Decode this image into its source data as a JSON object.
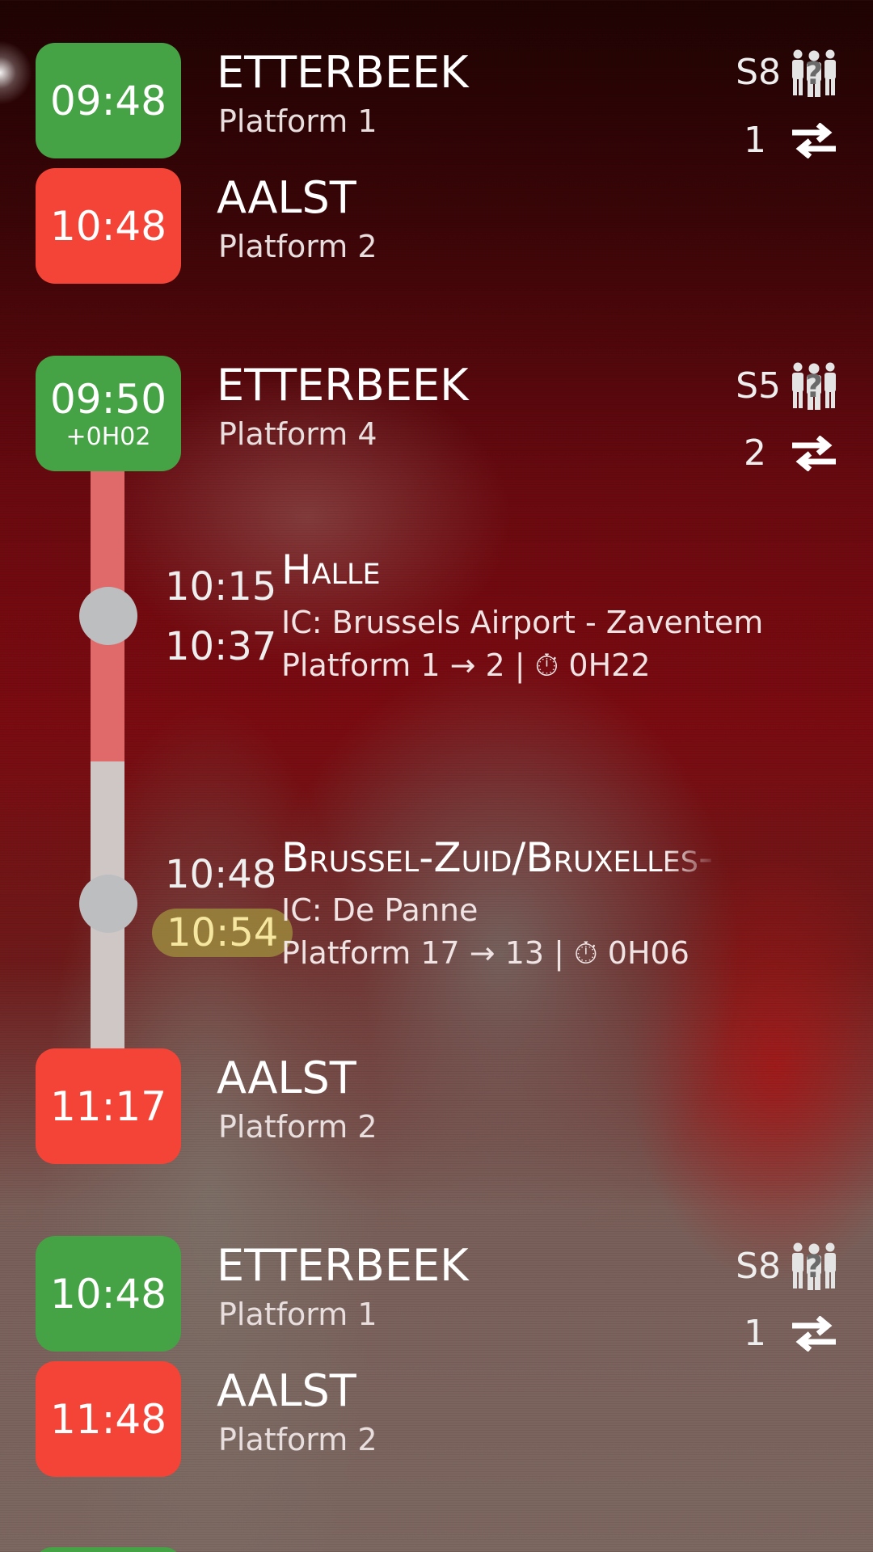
{
  "connections": [
    {
      "departure": {
        "time": "09:48",
        "station": "ETTERBEEK",
        "platform": "Platform 1"
      },
      "arrival": {
        "time": "10:48",
        "station": "AALST",
        "platform": "Platform 2"
      },
      "train_line": "S8",
      "transfers": "1",
      "occupancy_icon": "people-unknown-icon",
      "transfers_icon": "swap-arrows-icon"
    },
    {
      "departure": {
        "time": "09:50",
        "delay": "+0H02",
        "station": "ETTERBEEK",
        "platform": "Platform 4"
      },
      "arrival": {
        "time": "11:17",
        "station": "AALST",
        "platform": "Platform 2"
      },
      "train_line": "S5",
      "transfers": "2",
      "occupancy_icon": "people-unknown-icon",
      "transfers_icon": "swap-arrows-icon",
      "stops": [
        {
          "arrival_time": "10:15",
          "departure_time": "10:37",
          "name": "Halle",
          "train": "IC: Brussels Airport - Zaventem",
          "platforms": "Platform 1 → 2 |",
          "wait": "0H22",
          "wait_icon": "stopwatch-icon"
        },
        {
          "arrival_time": "10:48",
          "departure_time": "10:54",
          "name": "Brussel-Zuid/Bruxelles-Midi",
          "train": "IC: De Panne",
          "platforms": "Platform 17 → 13 |",
          "wait": "0H06",
          "wait_icon": "stopwatch-icon"
        }
      ]
    },
    {
      "departure": {
        "time": "10:48",
        "station": "ETTERBEEK",
        "platform": "Platform 1"
      },
      "arrival": {
        "time": "11:48",
        "station": "AALST",
        "platform": "Platform 2"
      },
      "train_line": "S8",
      "transfers": "1",
      "occupancy_icon": "people-unknown-icon",
      "transfers_icon": "swap-arrows-icon"
    }
  ],
  "colors": {
    "departure_badge": "#45a245",
    "arrival_badge": "#f44437",
    "track_done": "#e06a6a",
    "track_pending": "#cfc7c6",
    "stop_dot": "#bdbec0",
    "delay_highlight": "#9b873c"
  }
}
